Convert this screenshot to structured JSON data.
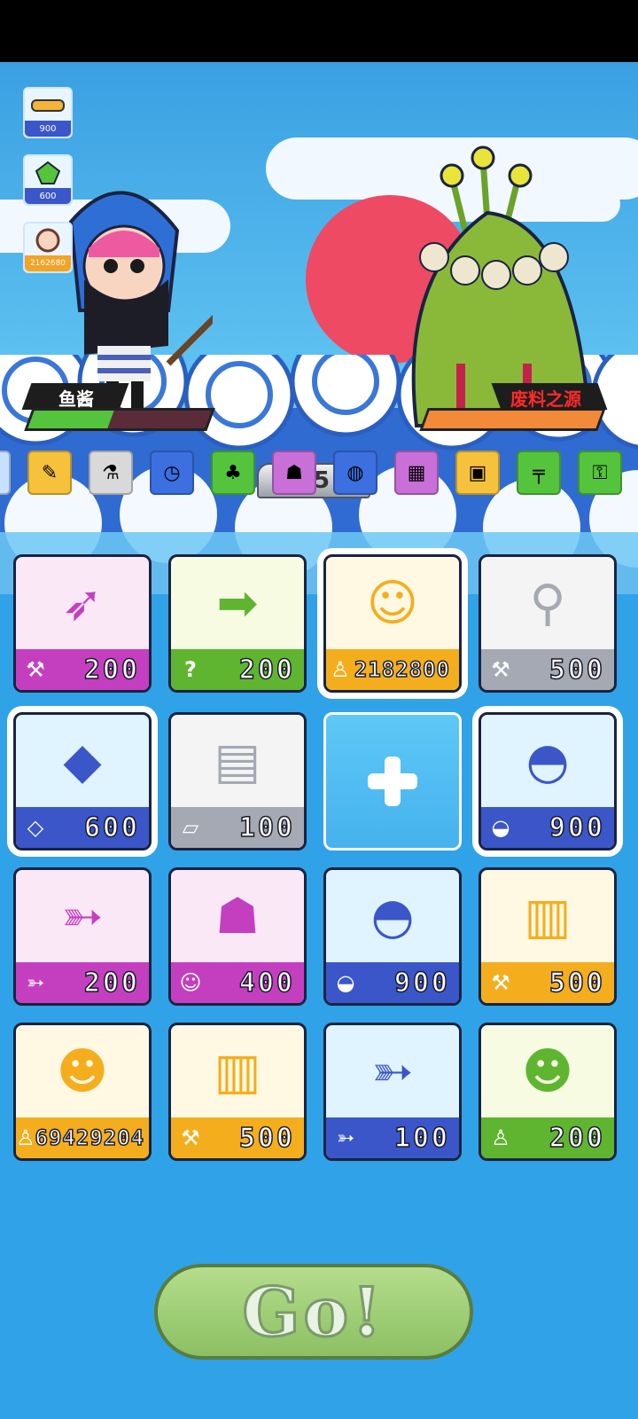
{
  "scene": {
    "side_items": [
      {
        "value": "900",
        "icon": "bread-icon",
        "style": "blue"
      },
      {
        "value": "600",
        "icon": "gem-icon",
        "style": "blue"
      },
      {
        "value": "2162680",
        "icon": "person-icon",
        "style": "orange"
      }
    ],
    "player": {
      "name": "鱼酱",
      "hp_fraction": 0.45,
      "hp_color": "#54c43c"
    },
    "enemy": {
      "name": "废料之源",
      "hp_fraction": 1.0,
      "hp_color": "#f28a3a"
    },
    "turn_counter": "45"
  },
  "icon_row": [
    {
      "icon": "partial-icon",
      "color": "#c8e0ff"
    },
    {
      "icon": "note-icon",
      "color": "#f6c23c"
    },
    {
      "icon": "bottle-icon",
      "color": "#d9d9d9"
    },
    {
      "icon": "clock-icon",
      "color": "#3c6fe0"
    },
    {
      "icon": "cactus-icon",
      "color": "#54c43c"
    },
    {
      "icon": "robot-icon",
      "color": "#c86fd8"
    },
    {
      "icon": "pan-icon",
      "color": "#3c6fe0"
    },
    {
      "icon": "calculator-icon",
      "color": "#c86fd8"
    },
    {
      "icon": "crate-icon",
      "color": "#f6c23c"
    },
    {
      "icon": "gun-icon",
      "color": "#54c43c"
    },
    {
      "icon": "lock-icon",
      "color": "#54c43c"
    }
  ],
  "cards": [
    {
      "item": "missile-icon",
      "cost_icon": "shovel-icon",
      "value": "200",
      "top": "#fbe8f7",
      "foot": "#c43fbf"
    },
    {
      "item": "arrow-icon",
      "cost_icon": "question-icon",
      "value": "200",
      "top": "#f6fbe2",
      "foot": "#5fb52f"
    },
    {
      "item": "girl-avatar-icon",
      "cost_icon": "person-icon",
      "value": "2182800",
      "top": "#fff8e3",
      "foot": "#f4ae1d",
      "selected": true
    },
    {
      "item": "stick-pot-icon",
      "cost_icon": "shovel-icon",
      "value": "500",
      "top": "#f4f4f4",
      "foot": "#a5a9b3"
    },
    {
      "item": "gem-icon",
      "cost_icon": "diamond-icon",
      "value": "600",
      "top": "#dff4ff",
      "foot": "#3a56c8",
      "selected": true
    },
    {
      "item": "book-icon",
      "cost_icon": "eraser-icon",
      "value": "100",
      "top": "#f4f4f4",
      "foot": "#a5a9b3"
    },
    {
      "item": "burrito-icon",
      "cost_icon": "bread-icon",
      "value": "900",
      "top": "#dff4ff",
      "foot": "#3a56c8",
      "selected": true
    },
    {
      "item": "koi-fish-icon",
      "cost_icon": "fish-icon",
      "value": "200",
      "top": "#fbe8f7",
      "foot": "#c43fbf"
    },
    {
      "item": "cat-icon",
      "cost_icon": "cat-face-icon",
      "value": "400",
      "top": "#fbe8f7",
      "foot": "#c43fbf"
    },
    {
      "item": "burrito-icon",
      "cost_icon": "bread-icon",
      "value": "900",
      "top": "#dff4ff",
      "foot": "#3a56c8"
    },
    {
      "item": "abacus-icon",
      "cost_icon": "shovel-icon",
      "value": "500",
      "top": "#fff8e3",
      "foot": "#f4ae1d"
    },
    {
      "item": "scientist-avatar-icon",
      "cost_icon": "person-icon",
      "value": "69429204",
      "top": "#fff8e3",
      "foot": "#f4ae1d"
    },
    {
      "item": "abacus-icon",
      "cost_icon": "shovel-icon",
      "value": "500",
      "top": "#fff8e3",
      "foot": "#f4ae1d"
    },
    {
      "item": "fish-icon",
      "cost_icon": "fish-icon",
      "value": "100",
      "top": "#dff4ff",
      "foot": "#3a56c8"
    },
    {
      "item": "money-man-icon",
      "cost_icon": "person-icon",
      "value": "200",
      "top": "#f6fbe2",
      "foot": "#5fb52f"
    }
  ],
  "go_button": {
    "label": "Go!"
  }
}
